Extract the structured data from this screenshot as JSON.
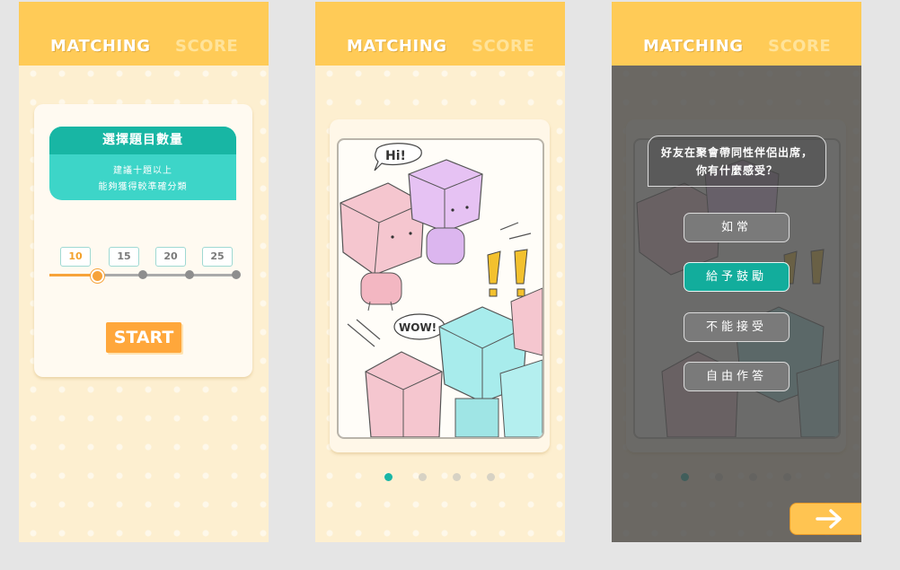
{
  "tabs": {
    "matching": "MATCHING",
    "score": "SCORE"
  },
  "screen1": {
    "question_count_title": "選擇題目數量",
    "hint_line1": "建議十題以上",
    "hint_line2": "能夠獲得較準確分類",
    "options": [
      "10",
      "15",
      "20",
      "25"
    ],
    "selected_option": "10",
    "start_label": "START"
  },
  "screen2": {
    "speech_hi": "Hi!",
    "speech_wow": "WOW!",
    "exclaim": "!!",
    "pagination_count": 4,
    "active_page": 1
  },
  "screen3": {
    "question_line1": "好友在聚會帶同性伴侶出席，",
    "question_line2": "你有什麼感受？",
    "answers": [
      "如常",
      "給予鼓勵",
      "不能接受",
      "自由作答"
    ],
    "selected_answer": "給予鼓勵"
  },
  "colors": {
    "header": "#ffcb57",
    "background": "#fdefd0",
    "teal": "#18b6a4",
    "orange": "#ffa73b"
  },
  "icons": {
    "next": "arrow-right-icon"
  }
}
